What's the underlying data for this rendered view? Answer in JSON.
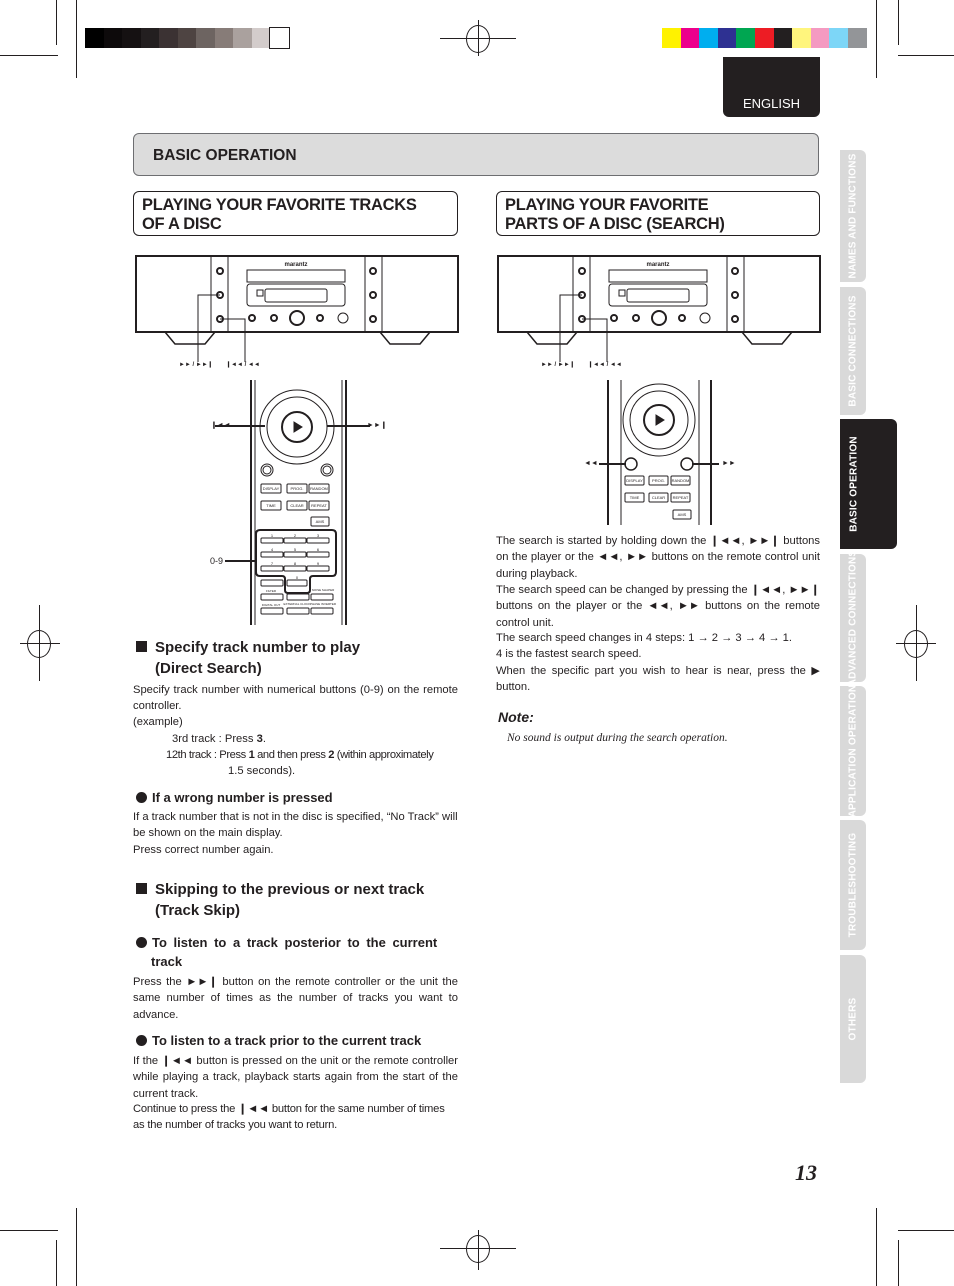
{
  "print_marks": {
    "grayscale_swatches": [
      "#000000",
      "#0d0a0b",
      "#151112",
      "#231f20",
      "#3b3233",
      "#4e4442",
      "#6d6461",
      "#877c78",
      "#aaa19e",
      "#d3cccb",
      "#ffffff"
    ],
    "color_swatches": [
      "#fff200",
      "#ec008c",
      "#00aeef",
      "#2e3192",
      "#00a651",
      "#ed1c24",
      "#231f20",
      "#fff57d",
      "#f49ac1",
      "#7dd6f7",
      "#939598"
    ]
  },
  "header": {
    "language_tab": "ENGLISH",
    "section_title": "BASIC OPERATION"
  },
  "side_tabs": [
    {
      "label": "NAMES AND FUNCTIONS",
      "active": false
    },
    {
      "label": "BASIC CONNECTIONS",
      "active": false
    },
    {
      "label": "BASIC OPERATION",
      "active": true
    },
    {
      "label": "ADVANCED CONNECTIONS",
      "active": false
    },
    {
      "label": "APPLICATION OPERATION",
      "active": false
    },
    {
      "label": "TROUBLESHOOTING",
      "active": false
    },
    {
      "label": "OTHERS",
      "active": false
    }
  ],
  "left": {
    "title_line1": "PLAYING YOUR FAVORITE TRACKS",
    "title_line2": "OF A DISC",
    "player_labels": {
      "next": "►► / ►►❙",
      "prev": "❙◄◄ / ◄◄"
    },
    "remote_labels": {
      "prev_icon": "❙◄◄",
      "next_icon": "►►❙",
      "numeric": "0-9"
    },
    "remote_buttons": {
      "row1": [
        "DISPLAY",
        "PROG.",
        "RANDOM"
      ],
      "row2": [
        "TIME",
        "CLEAR",
        "REPEAT"
      ],
      "ams": "AMS",
      "digits": [
        "1",
        "2",
        "3",
        "4",
        "5",
        "6",
        "7",
        "8",
        "9",
        "0"
      ],
      "extra": [
        "FILTER",
        "NOISE SHAPER",
        "DIGITAL OUT",
        "EXTERNAL CLOCK",
        "PHASE INVERTER"
      ]
    },
    "direct_search": {
      "heading_line1": "Specify track number to play",
      "heading_line2": "(Direct Search)",
      "intro": "Specify track number with numerical buttons (0-9) on the remote controller.",
      "example_label": "(example)",
      "ex1_label": "3rd track : ",
      "ex1_text": "Press ",
      "ex1_bold": "3",
      "ex1_end": ".",
      "ex2_label": "12th track : ",
      "ex2_a": "Press ",
      "ex2_b1": "1",
      "ex2_c": " and then press ",
      "ex2_b2": "2",
      "ex2_d": " (within approximately",
      "ex2_e": "1.5 seconds)."
    },
    "wrong_number": {
      "heading": "If a wrong number is pressed",
      "line1": "If a track number that is not in the disc is specified, “No Track” will be shown on the main display.",
      "line2": "Press correct number again."
    },
    "track_skip": {
      "heading_line1": "Skipping to the previous or next track",
      "heading_line2": "(Track Skip)",
      "posterior_heading_line1": "To listen to a track posterior to the current",
      "posterior_heading_line2": "track",
      "posterior_text": "Press the ►►❙ button on the remote controller or the unit the same number of times as the number of tracks you want to advance.",
      "prior_heading": "To listen to a track prior to the current track",
      "prior_text1": "If the ❙◄◄ button is pressed on the unit or the remote controller while playing a track, playback starts again from the start of the current track.",
      "prior_text2": "Continue to press the ❙◄◄ button for the same number of times as the number of tracks you want to return."
    }
  },
  "right": {
    "title_line1": "PLAYING YOUR FAVORITE",
    "title_line2": "PARTS OF A DISC (SEARCH)",
    "player_labels": {
      "next": "►► / ►►❙",
      "prev": "❙◄◄ / ◄◄"
    },
    "remote_labels": {
      "rew": "◄◄",
      "ff": "►►"
    },
    "p1": "The search is started by holding down the ❙◄◄, ►►❙ buttons on the player or the ◄◄, ►► buttons on the remote control unit during playback.",
    "p2": "The search speed can be changed by pressing the ❙◄◄, ►►❙ buttons on the player or the ◄◄, ►► buttons on the remote control unit.",
    "p3": "The search speed changes in 4 steps: 1 → 2 → 3 → 4 → 1.",
    "p4": "4 is the fastest search speed.",
    "p5": "When the specific part you wish to hear is near, press the ▶ button.",
    "note_heading": "Note:",
    "note_text": "No sound is output during the search operation."
  },
  "device": {
    "brand": "marantz"
  },
  "footer": {
    "page_number": "13"
  }
}
